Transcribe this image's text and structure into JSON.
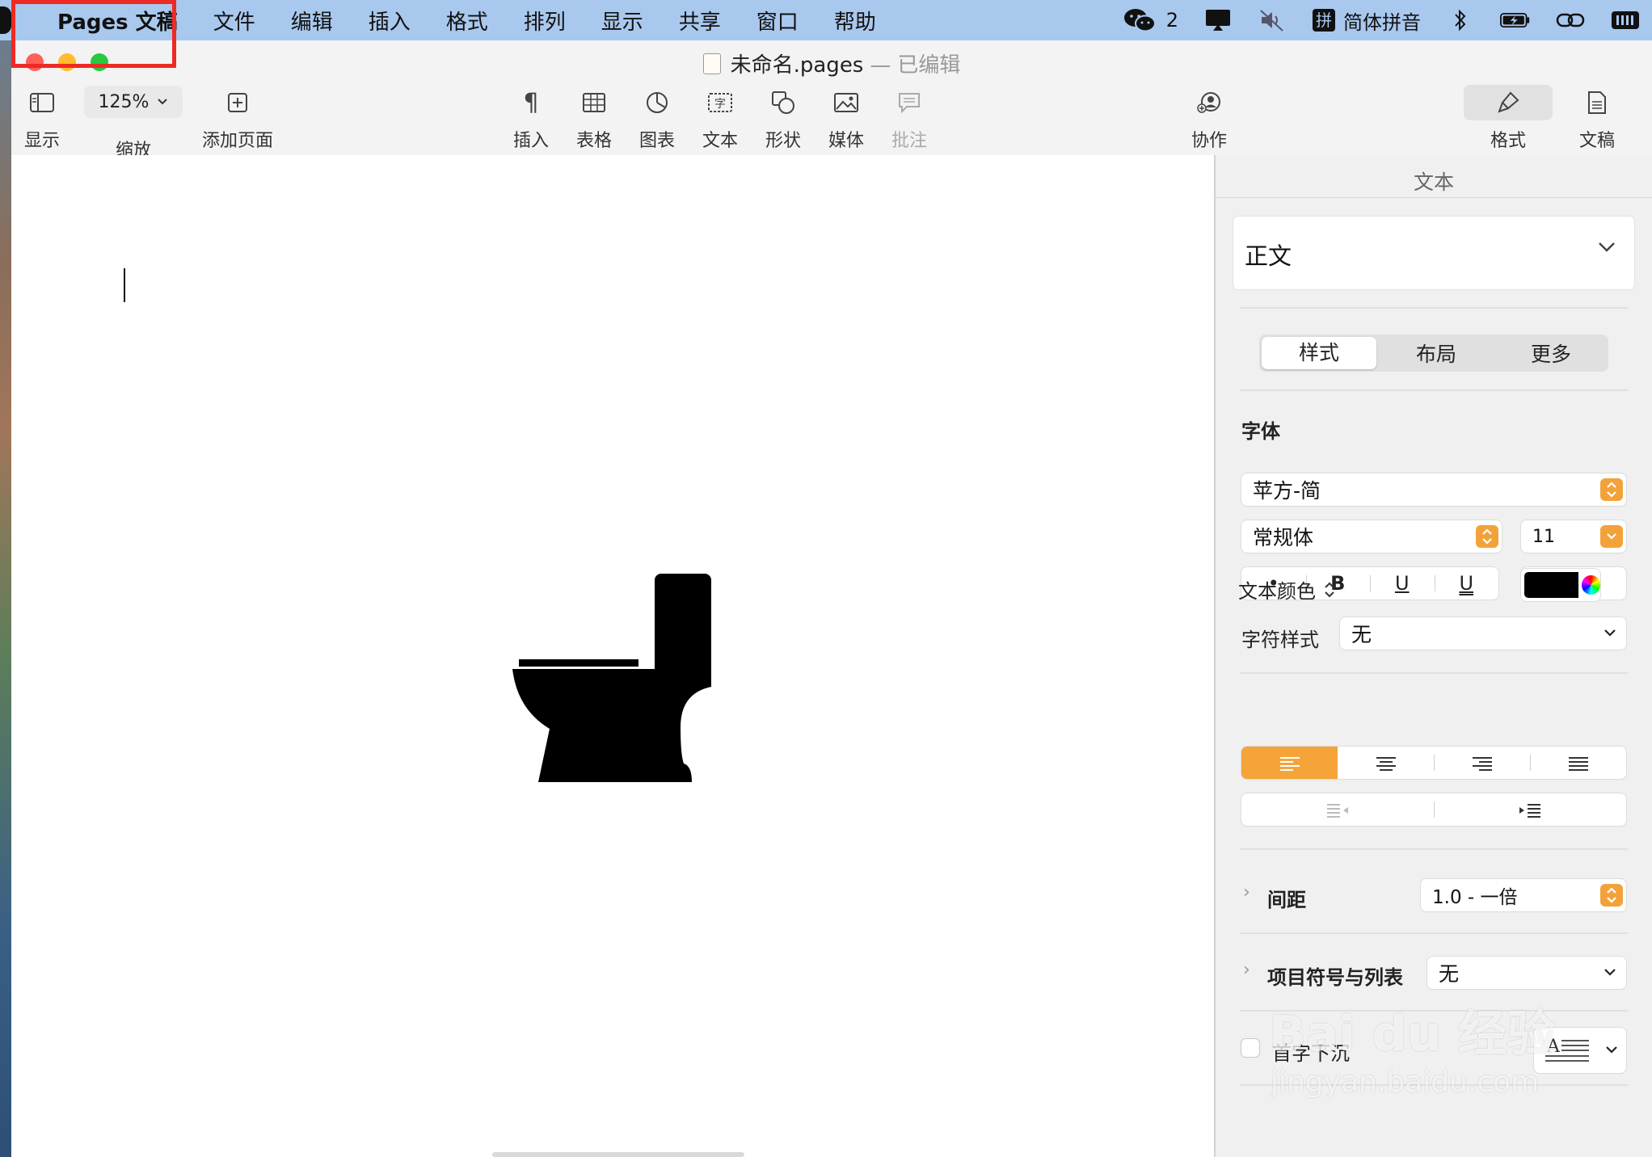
{
  "menubar": {
    "app_name": "Pages 文稿",
    "items": [
      "文件",
      "编辑",
      "插入",
      "格式",
      "排列",
      "显示",
      "共享",
      "窗口",
      "帮助"
    ],
    "wechat_count": "2",
    "input_method": "简体拼音"
  },
  "window": {
    "doc_title": "未命名.pages",
    "separator": "—",
    "doc_status": "已编辑"
  },
  "toolbar": {
    "view_label": "显示",
    "zoom_value": "125%",
    "zoom_label": "缩放",
    "add_page_label": "添加页面",
    "insert_label": "插入",
    "table_label": "表格",
    "chart_label": "图表",
    "text_label": "文本",
    "shape_label": "形状",
    "media_label": "媒体",
    "comment_label": "批注",
    "collaborate_label": "协作",
    "format_label": "格式",
    "document_label": "文稿"
  },
  "inspector": {
    "title": "文本",
    "paragraph_style": "正文",
    "tabs": [
      "样式",
      "布局",
      "更多"
    ],
    "font_section": "字体",
    "font_family": "苹方-简",
    "font_style": "常规体",
    "font_size": "11",
    "format_buttons": [
      "•",
      "B",
      "U",
      "U"
    ],
    "char_style_label": "字符样式",
    "char_style_value": "无",
    "text_color_label": "文本颜色",
    "text_color": "#000000",
    "spacing_label": "间距",
    "spacing_value": "1.0 - 一倍",
    "bullets_label": "项目符号与列表",
    "bullets_value": "无",
    "drop_cap_label": "首字下沉"
  },
  "watermark": {
    "brand": "Bai du 经验",
    "url": "jingyan.baidu.com"
  },
  "colors": {
    "accent": "#f5a43a",
    "menubar_bg": "#a9c8ee",
    "highlight_box": "#ee2a24"
  }
}
